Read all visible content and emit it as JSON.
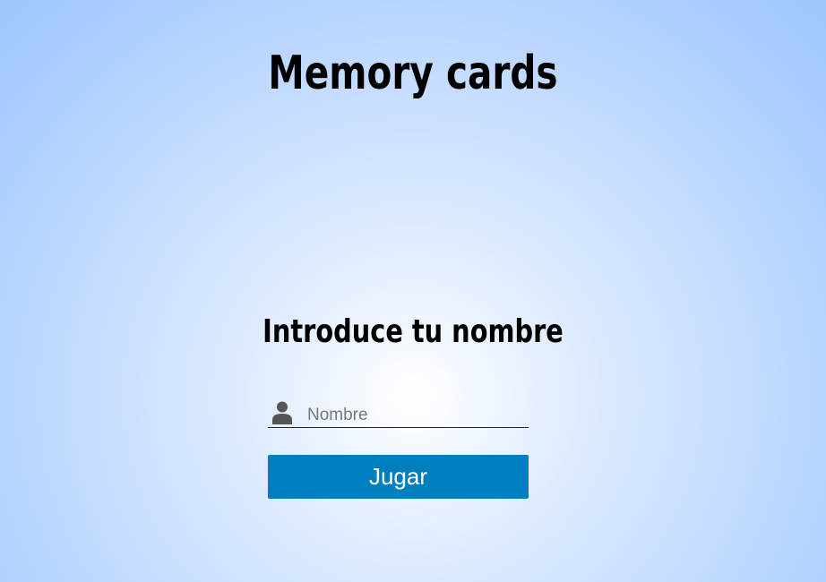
{
  "header": {
    "title": "Memory cards"
  },
  "form": {
    "heading": "Introduce tu nombre",
    "name_placeholder": "Nombre",
    "name_value": "",
    "submit_label": "Jugar"
  },
  "icons": {
    "name_field_icon": "user-icon"
  },
  "colors": {
    "button_background": "#007fbf",
    "button_text": "#ffffff",
    "icon": "#555555"
  }
}
